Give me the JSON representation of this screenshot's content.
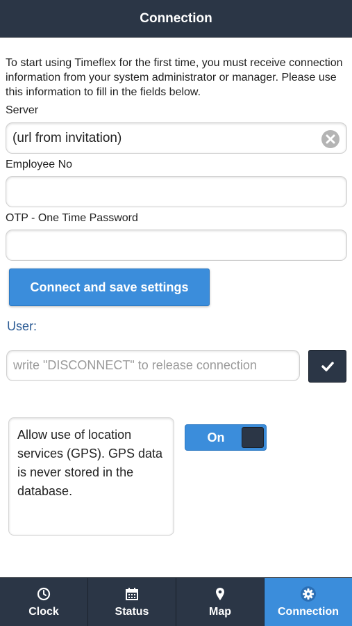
{
  "header": {
    "title": "Connection"
  },
  "intro": {
    "text": "To start using Timeflex for the first time, you must receive connection information from your system administrator or manager. Please use this information to fill in the fields below."
  },
  "form": {
    "server_label": "Server",
    "server_value": "(url from invitation)",
    "employee_label": "Employee No",
    "employee_value": "",
    "otp_label": "OTP - One Time Password",
    "otp_value": "",
    "connect_button": "Connect and save settings"
  },
  "user": {
    "label": "User:",
    "disconnect_placeholder": "write \"DISCONNECT\" to release connection",
    "disconnect_value": ""
  },
  "gps": {
    "text": "Allow use of location services (GPS). GPS data is never stored in the database.",
    "toggle_label": "On"
  },
  "navbar": {
    "items": [
      {
        "label": "Clock",
        "icon": "clock-icon"
      },
      {
        "label": "Status",
        "icon": "calendar-icon"
      },
      {
        "label": "Map",
        "icon": "map-marker-icon"
      },
      {
        "label": "Connection",
        "icon": "gear-icon"
      }
    ],
    "active_index": 3
  },
  "colors": {
    "header_bg": "#2b3646",
    "accent": "#3b8ddb",
    "user_label": "#2e5d96"
  }
}
